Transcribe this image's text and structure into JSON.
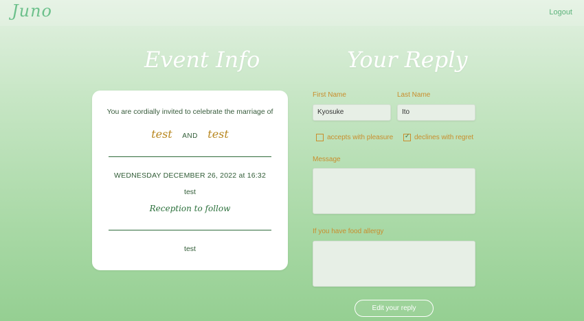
{
  "header": {
    "logo": "Juno",
    "logout_label": "Logout"
  },
  "event_info": {
    "title": "Event Info",
    "invite_text": "You are cordially invited to celebrate the marriage of",
    "name1": "test",
    "and_label": "AND",
    "name2": "test",
    "datetime": "WEDNESDAY DECEMBER 26, 2022 at 16:32",
    "venue": "test",
    "reception": "Reception to follow",
    "note": "test"
  },
  "reply": {
    "title": "Your Reply",
    "first_name_label": "First Name",
    "first_name_value": "Kyosuke",
    "last_name_label": "Last Name",
    "last_name_value": "Ito",
    "accept_label": "accepts with pleasure",
    "accept_checked": false,
    "decline_label": "declines with regret",
    "decline_checked": true,
    "message_label": "Message",
    "message_value": "",
    "allergy_label": "If you have food allergy",
    "allergy_value": "",
    "submit_label": "Edit your reply"
  },
  "colors": {
    "accent_gold": "#c98d2c",
    "green_dark": "#2d6a3a",
    "logo_green": "#6cc08b"
  }
}
